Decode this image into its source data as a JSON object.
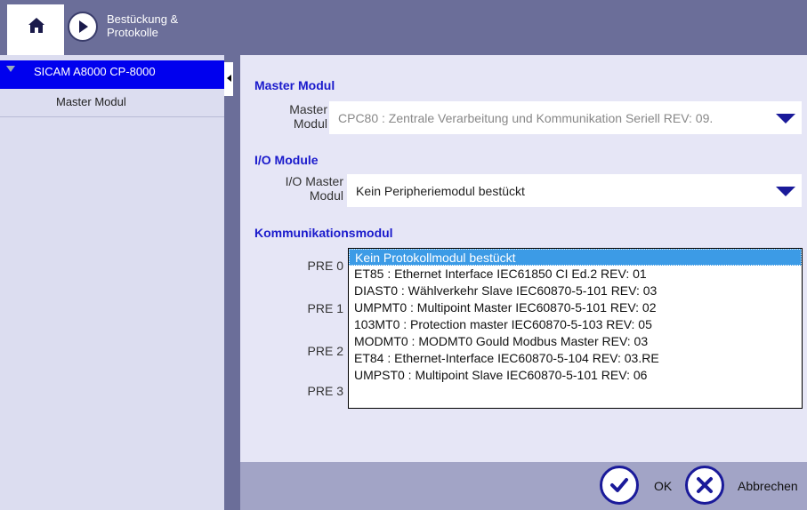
{
  "header": {
    "title": "Bestückung & Protokolle"
  },
  "sidebar": {
    "root_label": "SICAM A8000 CP-8000",
    "child_label": "Master Modul"
  },
  "main": {
    "master_section": "Master Modul",
    "master_label": "Master Modul",
    "master_value": "CPC80 : Zentrale Verarbeitung und Kommunikation Seriell REV: 09.",
    "io_section": "I/O Module",
    "io_label": "I/O Master Modul",
    "io_value": "Kein Peripheriemodul bestückt",
    "comm_section": "Kommunikationsmodul",
    "pre_labels": [
      "PRE 0",
      "PRE 1",
      "PRE 2",
      "PRE 3"
    ],
    "options": [
      "Kein Protokollmodul bestückt",
      "ET85 : Ethernet Interface IEC61850 CI Ed.2 REV: 01",
      "DIAST0 : Wählverkehr Slave IEC60870-5-101 REV: 03",
      "UMPMT0 : Multipoint Master IEC60870-5-101 REV: 02",
      "103MT0 : Protection master IEC60870-5-103 REV: 05",
      "MODMT0 : MODMT0 Gould Modbus Master REV: 03",
      "ET84 : Ethernet-Interface IEC60870-5-104 REV: 03.RE",
      "UMPST0 : Multipoint Slave IEC60870-5-101 REV: 06"
    ]
  },
  "footer": {
    "ok_label": "OK",
    "cancel_label": "Abbrechen"
  },
  "colors": {
    "header_bg": "#6b6e99",
    "tree_selected": "#0000ee",
    "section_title": "#1a1acc",
    "option_selected": "#3c9be6"
  },
  "icons": [
    "home-icon",
    "forward-arrow-icon",
    "collapse-icon",
    "checkmark-icon",
    "cross-icon"
  ]
}
